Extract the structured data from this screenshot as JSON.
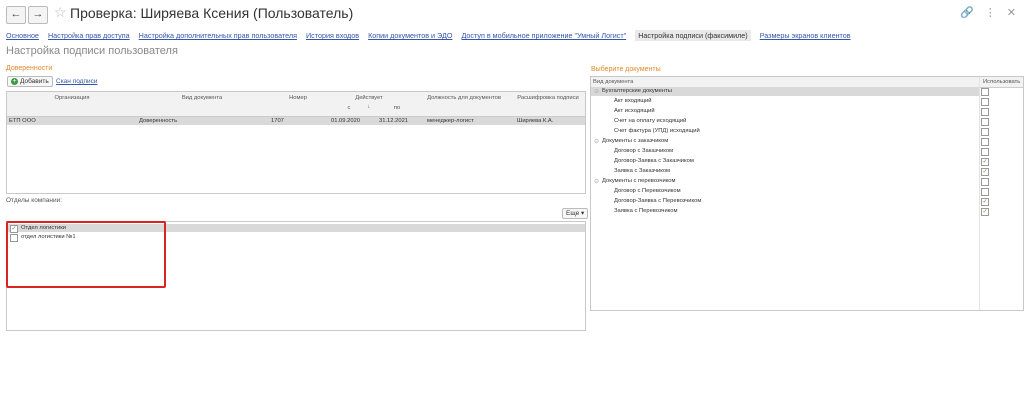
{
  "window": {
    "title": "Проверка: Ширяева Ксения (Пользователь)",
    "back_icon": "arrow-left-icon",
    "forward_icon": "arrow-right-icon",
    "star_icon": "star-icon",
    "link_icon": "link-icon",
    "menu_icon": "more-vertical-icon",
    "close_icon": "close-icon"
  },
  "tabs": [
    {
      "label": "Основное",
      "active": false
    },
    {
      "label": "Настройка прав доступа",
      "active": false
    },
    {
      "label": "Настройка дополнительных прав пользователя",
      "active": false
    },
    {
      "label": "История входов",
      "active": false
    },
    {
      "label": "Копии документов и ЭДО",
      "active": false
    },
    {
      "label": "Доступ в мобильное приложение \"Умный Логист\"",
      "active": false
    },
    {
      "label": "Настройка подписи (факсимиле)",
      "active": true
    },
    {
      "label": "Размеры экранов клиентов",
      "active": false
    }
  ],
  "page_title": "Настройка подписи пользователя",
  "powers": {
    "section_label": "Доверенности",
    "add_button": "Добавить",
    "scan_link": "Скан подписи",
    "columns": {
      "org": "Организация",
      "doc_type": "Вид документа",
      "number": "Номер",
      "valid": "Действует",
      "from": "с",
      "to": "по",
      "position": "Должность для документов",
      "signature": "Расшифровка подписи"
    },
    "rows": [
      {
        "org": "ЕТП ООО",
        "doc_type": "Доверенность",
        "number": "1707",
        "from": "01.09.2020",
        "to": "31.12.2021",
        "position": "менеджер-логист",
        "signature": "Ширяева К.А."
      }
    ]
  },
  "departments": {
    "label": "Отделы компании:",
    "more_button": "Еще ▾",
    "rows": [
      {
        "label": "Отдел логистики",
        "checked": true
      },
      {
        "label": "отдел логистики №1",
        "checked": false
      }
    ]
  },
  "documents": {
    "section_label": "Выберите документы",
    "columns": {
      "doc_type": "Вид документа",
      "use": "Использовать"
    },
    "rows": [
      {
        "label": "Бухгалтерские документы",
        "group": true,
        "checked": false
      },
      {
        "label": "Акт входящий",
        "group": false,
        "checked": false
      },
      {
        "label": "Акт исходящий",
        "group": false,
        "checked": false
      },
      {
        "label": "Счет на оплату исходящий",
        "group": false,
        "checked": false
      },
      {
        "label": "Счет фактура (УПД) исходящий",
        "group": false,
        "checked": false
      },
      {
        "label": "Документы с заказчиком",
        "group": true,
        "checked": false
      },
      {
        "label": "Договор с Заказчиком",
        "group": false,
        "checked": false
      },
      {
        "label": "Договор-Заявка с Заказчиком",
        "group": false,
        "checked": true
      },
      {
        "label": "Заявка с Заказчиком",
        "group": false,
        "checked": true
      },
      {
        "label": "Документы с перевозчиком",
        "group": true,
        "checked": false
      },
      {
        "label": "Договор с Перевозчиком",
        "group": false,
        "checked": false
      },
      {
        "label": "Договор-Заявка с Перевозчиком",
        "group": false,
        "checked": true
      },
      {
        "label": "Заявка с Перевозчиком",
        "group": false,
        "checked": true
      }
    ]
  }
}
